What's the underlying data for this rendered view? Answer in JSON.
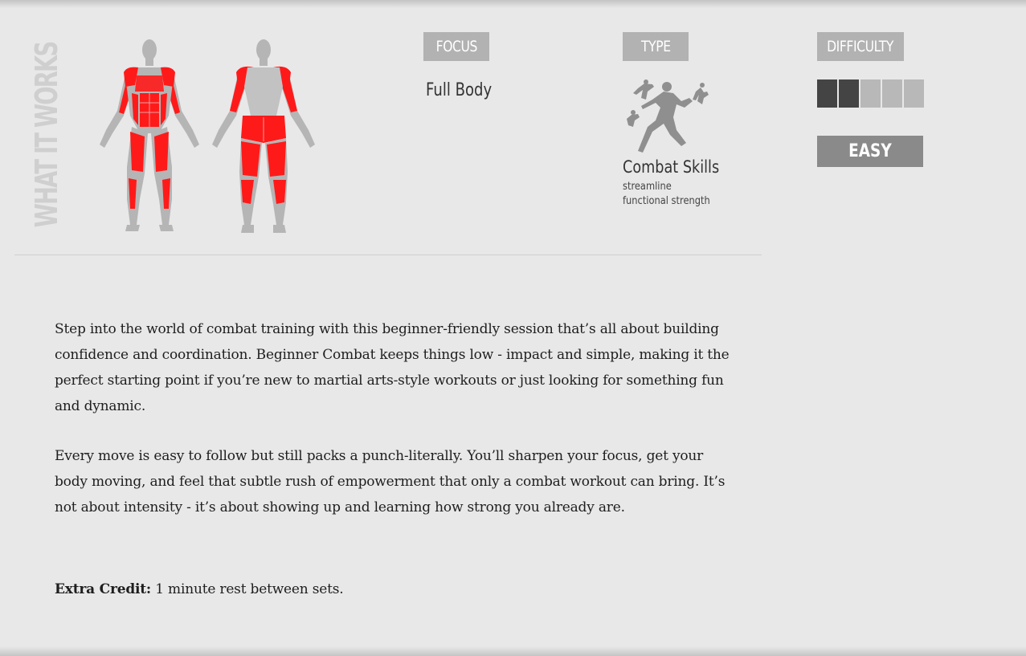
{
  "section_title": "WHAT IT WORKS",
  "focus": {
    "label": "FOCUS",
    "value": "Full Body"
  },
  "type": {
    "label": "TYPE",
    "icon": "combat-fighters-icon",
    "name": "Combat Skills",
    "desc_line1": "streamline",
    "desc_line2": "functional strength"
  },
  "difficulty": {
    "label": "DIFFICULTY",
    "level": "EASY",
    "filled_segments": 2,
    "total_segments": 5
  },
  "description": {
    "para1": "Step into the world of combat training with this beginner-friendly session that’s all about building confidence and coordination. Beginner Combat keeps things low - impact and simple, making it the perfect starting point if you’re new to martial arts-style workouts or just looking for something fun and dynamic.",
    "para2": "Every move is easy to follow but still packs a punch-literally. You’ll sharpen your focus, get your body moving, and feel that subtle rush of empowerment that only a combat workout can bring. It’s not about intensity - it’s about showing up and learning how strong you already are.",
    "extra_label": "Extra Credit:",
    "extra_text": " 1 minute rest between sets."
  },
  "colors": {
    "muscle_highlight": "#ff1a1a",
    "body_gray": "#b5b5b5",
    "label_bg": "#b2b2b2",
    "bar_on": "#444444",
    "bar_off": "#b8b8b8",
    "badge_bg": "#8a8a8a"
  }
}
